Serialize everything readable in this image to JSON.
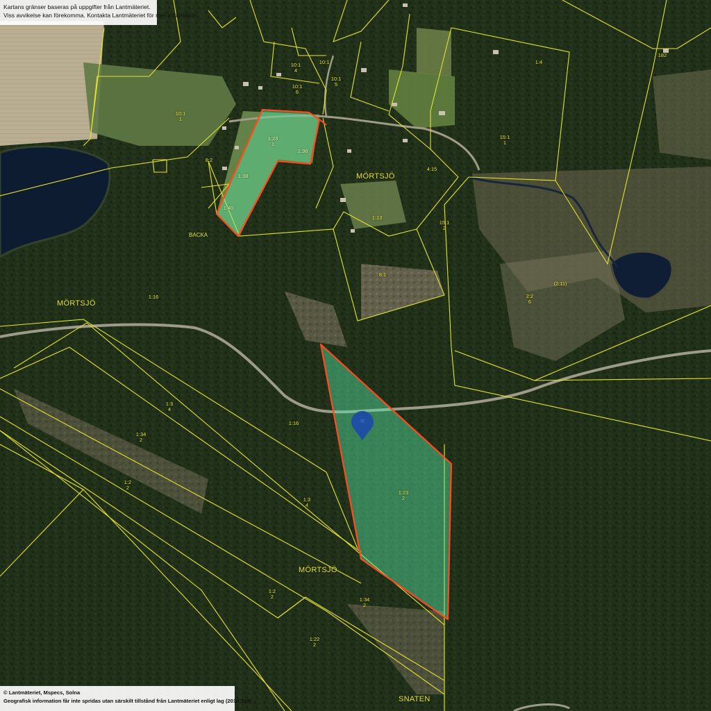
{
  "notices": {
    "top_line_1": "Kartans gränser baseras på uppgifter från Lantmäteriet.",
    "top_line_2": "Viss avvikelse kan förekomma. Kontakta Lantmäteriet för mer information.",
    "bottom_line_1": "© Lantmäteriet, Mspecs, Solna",
    "bottom_line_2": "Geografisk information får inte spridas utan särskilt tillstånd från Lantmäteriet enligt lag (2016:319)"
  },
  "place_names": {
    "mortsjo_north": "MÖRTSJÖ",
    "mortsjo_west": "MÖRTSJÖ",
    "mortsjo_south": "MÖRTSJÖ",
    "backa": "BACKA",
    "snaten": "SNATEN"
  },
  "plots": {
    "p_10_1_a": {
      "a": "10:1",
      "b": "1"
    },
    "p_10_1_b": {
      "a": "10:1",
      "b": "4"
    },
    "p_10_1_c": {
      "a": "10:1",
      "b": "6"
    },
    "p_10_1_d": {
      "a": "10:1",
      "b": "5"
    },
    "p_10_1_e": {
      "a": "10:1",
      "b": ""
    },
    "p_1_23_north": {
      "a": "1:23",
      "b": "1"
    },
    "p_1_4": {
      "a": "1:4",
      "b": ""
    },
    "p_15_1_a": {
      "a": "15:1",
      "b": "1"
    },
    "p_15_1_b": {
      "a": "15:1",
      "b": "2"
    },
    "p_4_15": {
      "a": "4:15",
      "b": ""
    },
    "p_1_13": {
      "a": "1:13",
      "b": ""
    },
    "p_8_1": {
      "a": "8:1",
      "b": ""
    },
    "p_8_2": {
      "a": "8:2",
      "b": ""
    },
    "p_2_2": {
      "a": "2:2",
      "b": "6"
    },
    "p_2_11": {
      "a": "(2:11)",
      "b": ""
    },
    "p_1_16_a": {
      "a": "1:16",
      "b": ""
    },
    "p_1_16_b": {
      "a": "1:16",
      "b": ""
    },
    "p_1_3_a": {
      "a": "1:3",
      "b": "4"
    },
    "p_1_3_b": {
      "a": "1:3",
      "b": "4"
    },
    "p_1_34_a": {
      "a": "1:34",
      "b": "2"
    },
    "p_1_34_b": {
      "a": "1:34",
      "b": "2"
    },
    "p_1_2_a": {
      "a": "1:2",
      "b": "2"
    },
    "p_1_2_b": {
      "a": "1:2",
      "b": "2"
    },
    "p_1_22": {
      "a": "1:22",
      "b": "2"
    },
    "p_1_23_south": {
      "a": "1:23",
      "b": "2"
    },
    "p_182": {
      "a": "182",
      "b": ""
    },
    "p_1_36": {
      "a": "1:36",
      "b": ""
    },
    "p_1_38": {
      "a": "1:38",
      "b": ""
    },
    "p_1_40": {
      "a": "1:40",
      "b": ""
    }
  },
  "colors": {
    "boundary_yellow": "#e6e32b",
    "selection_fill": "#56e7a6",
    "selection_stroke": "#ff4a1c",
    "marker_blue": "#1f4fa3",
    "water": "#0d1d33",
    "forest_dark": "#1e2e19",
    "forest_mid": "#2c3d22",
    "field_green": "#5d7442",
    "clearcut": "#8a8570",
    "road": "#9c9a8c"
  },
  "icons": {
    "location_marker": "location-pin-icon"
  }
}
